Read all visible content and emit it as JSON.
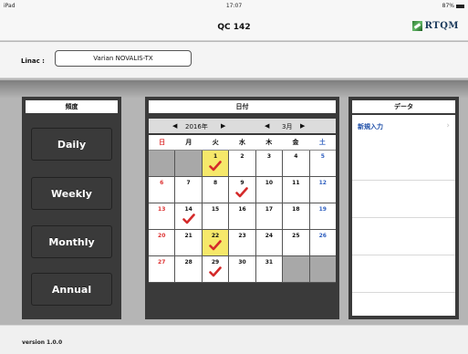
{
  "status_bar": {
    "device": "iPad",
    "time": "17:07",
    "battery": "87%"
  },
  "app": {
    "title": "QC 142",
    "logo_text": "RTQM"
  },
  "linac": {
    "label": "Linac :",
    "value": "Varian NOVALIS-TX"
  },
  "frequency_panel": {
    "header": "頻度",
    "buttons": [
      {
        "label": "Daily",
        "selected": false
      },
      {
        "label": "Weekly",
        "selected": true
      },
      {
        "label": "Monthly",
        "selected": false
      },
      {
        "label": "Annual",
        "selected": false
      }
    ]
  },
  "date_panel": {
    "header": "日付",
    "year_nav": {
      "prev": "◀",
      "label": "2016年",
      "next": "▶"
    },
    "month_nav": {
      "prev": "◀",
      "label": "3月",
      "next": "▶"
    },
    "weekday_headers": [
      "日",
      "月",
      "火",
      "水",
      "木",
      "金",
      "土"
    ],
    "weeks": [
      [
        "",
        "",
        "1",
        "2",
        "3",
        "4",
        "5"
      ],
      [
        "6",
        "7",
        "8",
        "9",
        "10",
        "11",
        "12"
      ],
      [
        "13",
        "14",
        "15",
        "16",
        "17",
        "18",
        "19"
      ],
      [
        "20",
        "21",
        "22",
        "23",
        "24",
        "25",
        "26"
      ],
      [
        "27",
        "28",
        "29",
        "30",
        "31",
        "",
        ""
      ]
    ],
    "highlighted_days": [
      "1",
      "22"
    ],
    "checked_days": [
      "1",
      "9",
      "14",
      "22",
      "29"
    ],
    "check_color": "#d42a2a",
    "highlight_color": "#f6e86a"
  },
  "data_panel": {
    "header": "データ",
    "items": [
      {
        "label": "新規入力"
      }
    ]
  },
  "footer": {
    "version": "version 1.0.0"
  }
}
